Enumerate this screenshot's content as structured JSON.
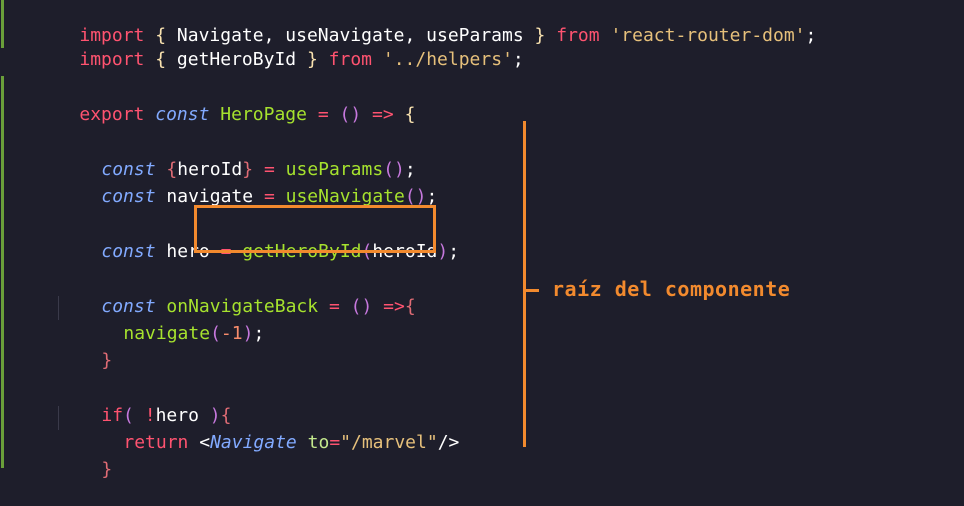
{
  "code": {
    "l1": {
      "kw1": "import",
      "b1": "{",
      "names": " Navigate, useNavigate, useParams ",
      "b2": "}",
      "kw2": "from",
      "str": "'react-router-dom'",
      "end": ";"
    },
    "l2": {
      "kw1": "import",
      "b1": "{",
      "names": " getHeroById ",
      "b2": "}",
      "kw2": "from",
      "str": "'../helpers'",
      "end": ";"
    },
    "l3": {
      "kw": "export",
      "decl": "const",
      "name": "HeroPage",
      "eq": "=",
      "parens": "()",
      "arrow": "=>",
      "brace": "{"
    },
    "l4": {
      "decl": "const",
      "b1": "{",
      "name": "heroId",
      "b2": "}",
      "eq": "=",
      "fn": "useParams",
      "call": "()",
      "end": ";"
    },
    "l5": {
      "decl": "const",
      "name": "navigate",
      "eq": "=",
      "fn": "useNavigate",
      "call": "()",
      "end": ";"
    },
    "l6": {
      "decl": "const",
      "name": "hero",
      "eq": "=",
      "fn": "getHeroById",
      "p1": "(",
      "arg": "heroId",
      "p2": ")",
      "end": ";"
    },
    "l7": {
      "decl": "const",
      "name": "onNavigateBack",
      "eq": "=",
      "parens": "()",
      "arrow": "=>",
      "brace": "{"
    },
    "l8": {
      "fn": "navigate",
      "p1": "(",
      "arg": "-1",
      "p2": ")",
      "end": ";"
    },
    "l9": {
      "brace": "}"
    },
    "l10": {
      "kw": "if",
      "p1": "(",
      "not": "!",
      "name": "hero",
      "p2": ")",
      "brace": "{"
    },
    "l11": {
      "kw": "return",
      "lt": "<",
      "tag": "Navigate",
      "attr": "to",
      "eq": "=",
      "str": "\"/marvel\"",
      "close": "/>"
    },
    "l12": {
      "brace": "}"
    }
  },
  "annotation": "raíz del componente",
  "colors": {
    "accent": "#f28a2e",
    "background": "#1e1e2b"
  }
}
